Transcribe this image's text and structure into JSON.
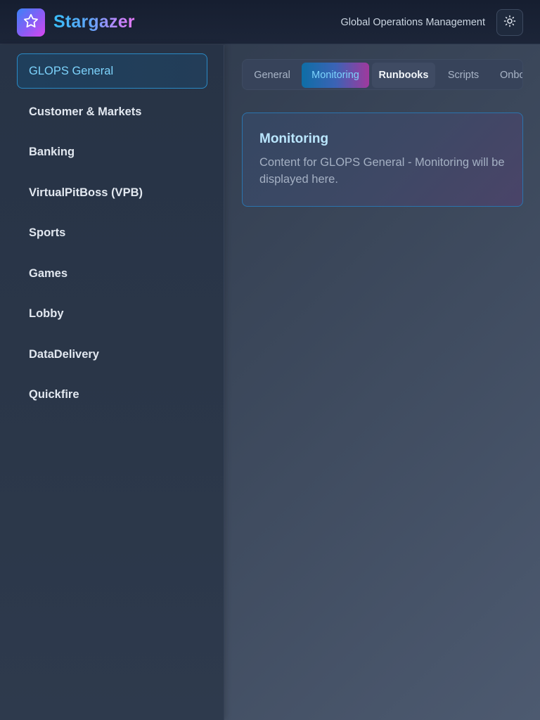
{
  "header": {
    "brand": "Stargazer",
    "subtitle": "Global Operations Management",
    "logo_icon": "star-icon",
    "theme_icon": "sun-icon"
  },
  "sidebar": {
    "items": [
      {
        "label": "GLOPS General",
        "active": true
      },
      {
        "label": "Customer & Markets"
      },
      {
        "label": "Banking"
      },
      {
        "label": "VirtualPitBoss (VPB)"
      },
      {
        "label": "Sports"
      },
      {
        "label": "Games"
      },
      {
        "label": "Lobby"
      },
      {
        "label": "DataDelivery"
      },
      {
        "label": "Quickfire"
      }
    ]
  },
  "tabs": [
    {
      "label": "General"
    },
    {
      "label": "Monitoring",
      "active": true
    },
    {
      "label": "Runbooks",
      "hover": true
    },
    {
      "label": "Scripts"
    },
    {
      "label": "Onboarding"
    }
  ],
  "content": {
    "title": "Monitoring",
    "text": "Content for GLOPS General - Monitoring will be displayed here."
  },
  "colors": {
    "accent": "#38bdf8",
    "active_border": "#2a8ac6",
    "brand_gradient_end": "#e879f9"
  }
}
